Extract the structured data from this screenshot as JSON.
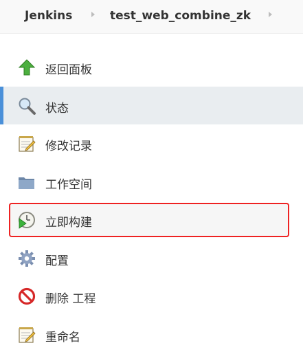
{
  "breadcrumb": {
    "root": "Jenkins",
    "job": "test_web_combine_zk"
  },
  "menu": {
    "items": [
      {
        "label": "返回面板",
        "icon": "up-arrow-icon"
      },
      {
        "label": "状态",
        "icon": "magnifier-icon",
        "active": true
      },
      {
        "label": "修改记录",
        "icon": "notepad-icon"
      },
      {
        "label": "工作空间",
        "icon": "folder-icon"
      },
      {
        "label": "立即构建",
        "icon": "build-now-clock-icon",
        "highlighted": true
      },
      {
        "label": "配置",
        "icon": "gear-icon"
      },
      {
        "label": "删除 工程",
        "icon": "no-entry-icon"
      },
      {
        "label": "重命名",
        "icon": "notepad-pencil-icon"
      }
    ]
  },
  "colors": {
    "active_bg": "#e9edf0",
    "active_accent": "#4a90d9",
    "highlight_border": "#ee2222"
  }
}
